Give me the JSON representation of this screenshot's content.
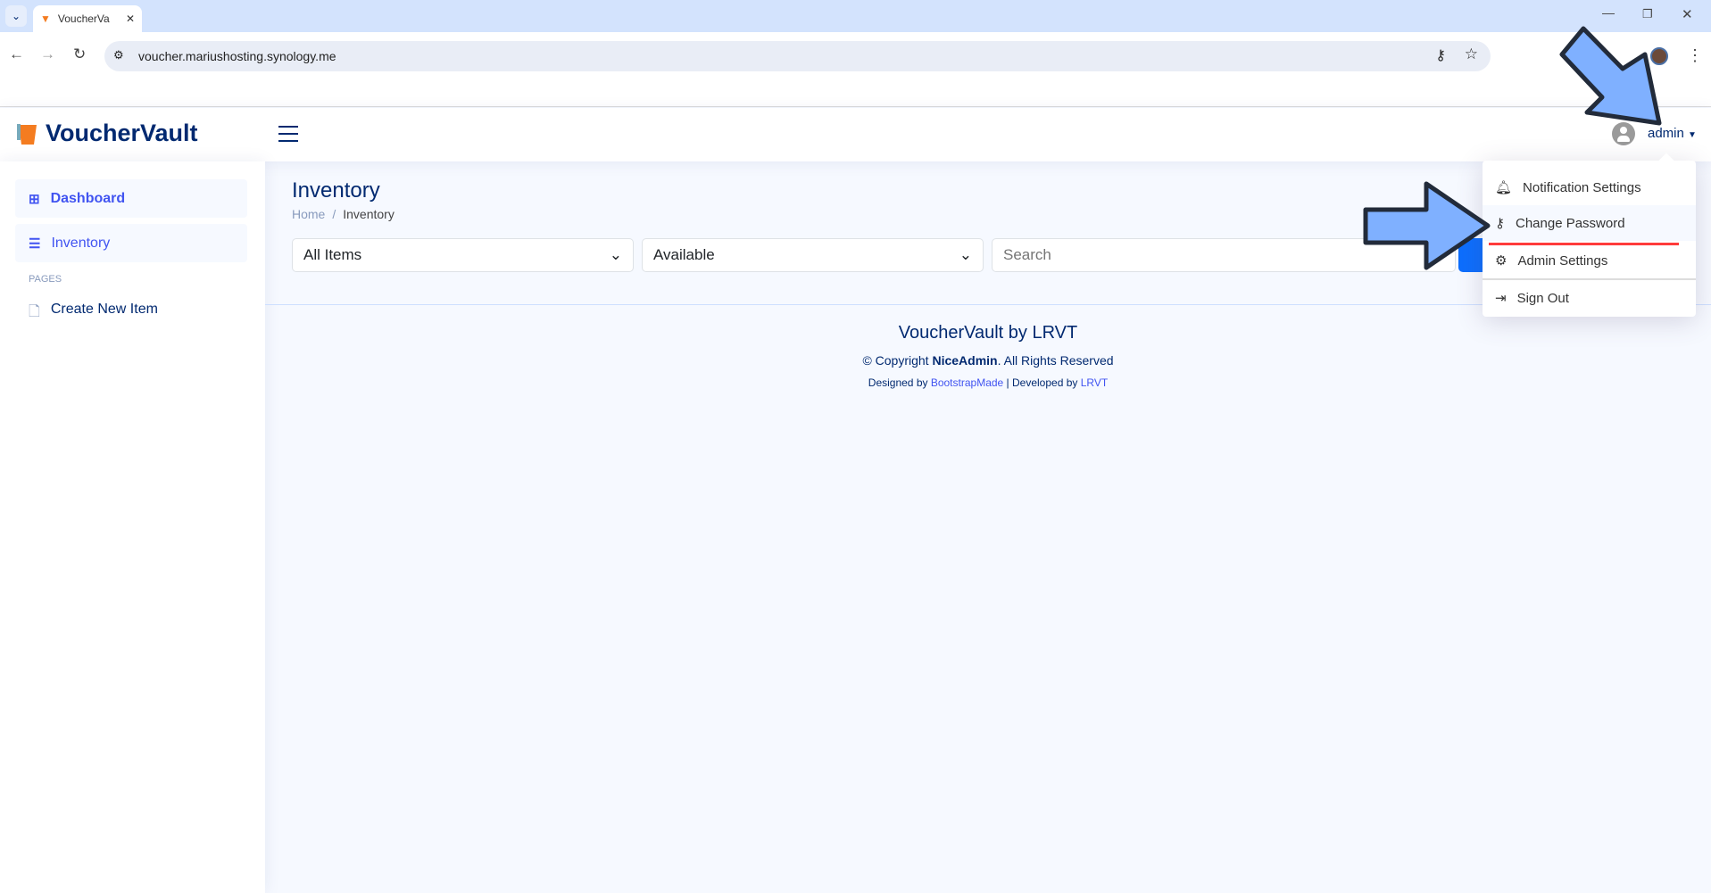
{
  "browser": {
    "tab_title": "VoucherVa",
    "url": "voucher.mariushosting.synology.me"
  },
  "app": {
    "name": "VoucherVault",
    "user": "admin"
  },
  "sidebar": {
    "items": [
      {
        "label": "Dashboard"
      },
      {
        "label": "Inventory"
      }
    ],
    "section": "PAGES",
    "pages": [
      {
        "label": "Create New Item"
      }
    ]
  },
  "main": {
    "title": "Inventory",
    "breadcrumb": [
      "Home",
      "Inventory"
    ],
    "filters": {
      "type": "All Items",
      "status": "Available",
      "search_placeholder": "Search"
    }
  },
  "dropdown": {
    "items": [
      {
        "label": "Notification Settings",
        "icon": "bell-icon"
      },
      {
        "label": "Change Password",
        "icon": "key-icon"
      },
      {
        "label": "Admin Settings",
        "icon": "gear-icon"
      },
      {
        "label": "Sign Out",
        "icon": "sign-out-icon"
      }
    ]
  },
  "footer": {
    "title": "VoucherVault by LRVT",
    "copyright_prefix": "© Copyright ",
    "copyright_brand": "NiceAdmin",
    "copyright_suffix": ". All Rights Reserved",
    "designed_by": "Designed by ",
    "designer": "BootstrapMade",
    "separator": " | Developed by ",
    "developer": "LRVT"
  },
  "colors": {
    "accent": "#4154f1",
    "brand": "#012970",
    "highlight": "#ff3b3b",
    "arrow": "#7fb0ff"
  }
}
